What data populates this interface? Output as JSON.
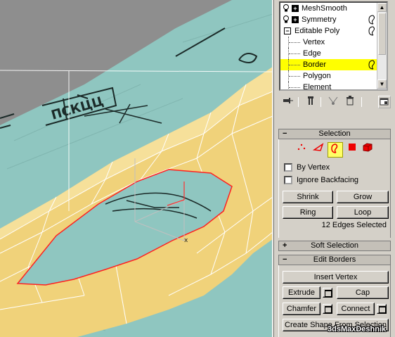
{
  "viewport": {
    "colors": {
      "background": "#8e8e8e",
      "texture": "#8fc6c0",
      "mesh": "#f0d27a",
      "wire": "#ffffff",
      "selection": "#ff0000"
    },
    "texture_label": "ПСКЦЦ"
  },
  "stack": {
    "items": [
      {
        "label": "MeshSmooth",
        "expander": "+",
        "icon": "lightbulb-icon"
      },
      {
        "label": "Symmetry",
        "expander": "+",
        "icon": "lightbulb-icon",
        "show_icon": "show-end-result-icon"
      },
      {
        "label": "Editable Poly",
        "expander": "−",
        "show_icon": "show-end-result-icon"
      },
      {
        "label": "Vertex"
      },
      {
        "label": "Edge"
      },
      {
        "label": "Border",
        "selected": true,
        "show_icon": "show-end-result-icon"
      },
      {
        "label": "Polygon"
      },
      {
        "label": "Element"
      }
    ],
    "selected_color": "#ffff00"
  },
  "toolbar": {
    "icons": [
      "pin-stack-icon",
      "show-end-result-icon",
      "make-unique-icon",
      "remove-modifier-icon",
      "configure-sets-icon"
    ]
  },
  "selection": {
    "title": "Selection",
    "sign": "−",
    "levels": [
      "vertex-level-icon",
      "edge-level-icon",
      "border-level-icon",
      "polygon-level-icon",
      "element-level-icon"
    ],
    "active_level": "border-level-icon",
    "by_vertex": "By Vertex",
    "ignore_backfacing": "Ignore Backfacing",
    "shrink": "Shrink",
    "grow": "Grow",
    "ring": "Ring",
    "loop": "Loop",
    "status": "12 Edges Selected"
  },
  "soft_selection": {
    "title": "Soft Selection",
    "sign": "+"
  },
  "edit_borders": {
    "title": "Edit Borders",
    "sign": "−",
    "insert_vertex": "Insert Vertex",
    "extrude": "Extrude",
    "cap": "Cap",
    "chamfer": "Chamfer",
    "connect": "Connect",
    "create_shape": "Create Shape From Selection"
  },
  "watermark": "3dsMaxDeshnik"
}
